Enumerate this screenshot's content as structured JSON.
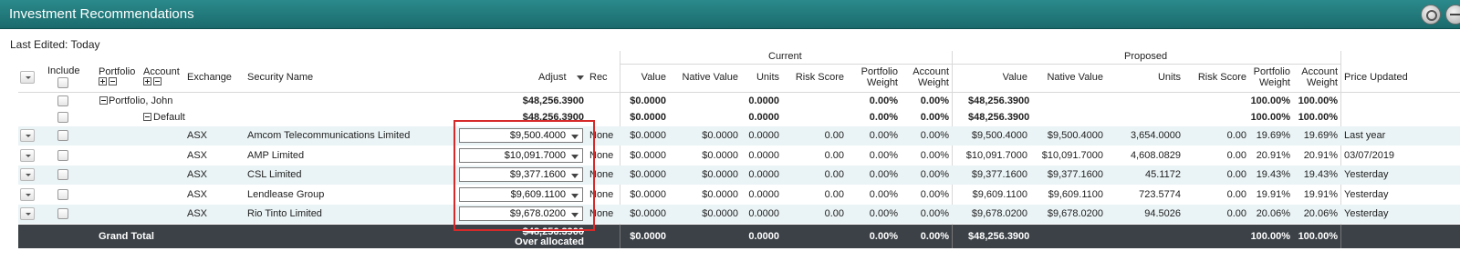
{
  "window": {
    "title": "Investment Recommendations",
    "settings_icon": "gear-icon",
    "collapse_icon": "minus-circle-icon"
  },
  "meta": {
    "last_edited_label": "Last Edited:",
    "last_edited_value": "Today"
  },
  "groups": {
    "current": "Current",
    "proposed": "Proposed"
  },
  "columns": {
    "include": "Include",
    "portfolio": "Portfolio",
    "account": "Account",
    "exchange": "Exchange",
    "security_name": "Security Name",
    "adjust": "Adjust",
    "rec": "Rec",
    "cur_value": "Value",
    "cur_native_value": "Native Value",
    "cur_units": "Units",
    "cur_risk_score": "Risk Score",
    "cur_portfolio_weight_1": "Portfolio",
    "cur_portfolio_weight_2": "Weight",
    "cur_account_weight_1": "Account",
    "cur_account_weight_2": "Weight",
    "prop_value": "Value",
    "prop_native_value": "Native Value",
    "prop_units": "Units",
    "prop_risk_score": "Risk Score",
    "prop_portfolio_weight_1": "Portfolio",
    "prop_portfolio_weight_2": "Weight",
    "prop_account_weight_1": "Account",
    "prop_account_weight_2": "Weight",
    "price_updated": "Price Updated"
  },
  "portfolio_row": {
    "label": "Portfolio, John",
    "adjust": "$48,256.3900",
    "cur_value": "$0.0000",
    "cur_units": "0.0000",
    "cur_pw": "0.00%",
    "cur_aw": "0.00%",
    "prop_value": "$48,256.3900",
    "prop_pw": "100.00%",
    "prop_aw": "100.00%"
  },
  "account_row": {
    "label": "Default",
    "adjust": "$48,256.3900",
    "cur_value": "$0.0000",
    "cur_units": "0.0000",
    "cur_pw": "0.00%",
    "cur_aw": "0.00%",
    "prop_value": "$48,256.3900",
    "prop_pw": "100.00%",
    "prop_aw": "100.00%"
  },
  "holdings": [
    {
      "exchange": "ASX",
      "name": "Amcom Telecommunications Limited",
      "adjust": "$9,500.4000",
      "rec": "None",
      "cur_value": "$0.0000",
      "cur_native": "$0.0000",
      "cur_units": "0.0000",
      "cur_risk": "0.00",
      "cur_pw": "0.00%",
      "cur_aw": "0.00%",
      "prop_value": "$9,500.4000",
      "prop_native": "$9,500.4000",
      "prop_units": "3,654.0000",
      "prop_risk": "0.00",
      "prop_pw": "19.69%",
      "prop_aw": "19.69%",
      "price_updated": "Last year"
    },
    {
      "exchange": "ASX",
      "name": "AMP Limited",
      "adjust": "$10,091.7000",
      "rec": "None",
      "cur_value": "$0.0000",
      "cur_native": "$0.0000",
      "cur_units": "0.0000",
      "cur_risk": "0.00",
      "cur_pw": "0.00%",
      "cur_aw": "0.00%",
      "prop_value": "$10,091.7000",
      "prop_native": "$10,091.7000",
      "prop_units": "4,608.0829",
      "prop_risk": "0.00",
      "prop_pw": "20.91%",
      "prop_aw": "20.91%",
      "price_updated": "03/07/2019"
    },
    {
      "exchange": "ASX",
      "name": "CSL Limited",
      "adjust": "$9,377.1600",
      "rec": "None",
      "cur_value": "$0.0000",
      "cur_native": "$0.0000",
      "cur_units": "0.0000",
      "cur_risk": "0.00",
      "cur_pw": "0.00%",
      "cur_aw": "0.00%",
      "prop_value": "$9,377.1600",
      "prop_native": "$9,377.1600",
      "prop_units": "45.1172",
      "prop_risk": "0.00",
      "prop_pw": "19.43%",
      "prop_aw": "19.43%",
      "price_updated": "Yesterday"
    },
    {
      "exchange": "ASX",
      "name": "Lendlease Group",
      "adjust": "$9,609.1100",
      "rec": "None",
      "cur_value": "$0.0000",
      "cur_native": "$0.0000",
      "cur_units": "0.0000",
      "cur_risk": "0.00",
      "cur_pw": "0.00%",
      "cur_aw": "0.00%",
      "prop_value": "$9,609.1100",
      "prop_native": "$9,609.1100",
      "prop_units": "723.5774",
      "prop_risk": "0.00",
      "prop_pw": "19.91%",
      "prop_aw": "19.91%",
      "price_updated": "Yesterday"
    },
    {
      "exchange": "ASX",
      "name": "Rio Tinto Limited",
      "adjust": "$9,678.0200",
      "rec": "None",
      "cur_value": "$0.0000",
      "cur_native": "$0.0000",
      "cur_units": "0.0000",
      "cur_risk": "0.00",
      "cur_pw": "0.00%",
      "cur_aw": "0.00%",
      "prop_value": "$9,678.0200",
      "prop_native": "$9,678.0200",
      "prop_units": "94.5026",
      "prop_risk": "0.00",
      "prop_pw": "20.06%",
      "prop_aw": "20.06%",
      "price_updated": "Yesterday"
    }
  ],
  "grand_total": {
    "label": "Grand Total",
    "adjust": "$48,256.3900",
    "adjust_note": "Over allocated",
    "cur_value": "$0.0000",
    "cur_units": "0.0000",
    "cur_pw": "0.00%",
    "cur_aw": "0.00%",
    "prop_value": "$48,256.3900",
    "prop_pw": "100.00%",
    "prop_aw": "100.00%"
  },
  "colors": {
    "title_bar": "#1f7a7c",
    "alt_row": "#eaf3f5",
    "total_row": "#3b4147",
    "highlight": "#d62a2a"
  }
}
